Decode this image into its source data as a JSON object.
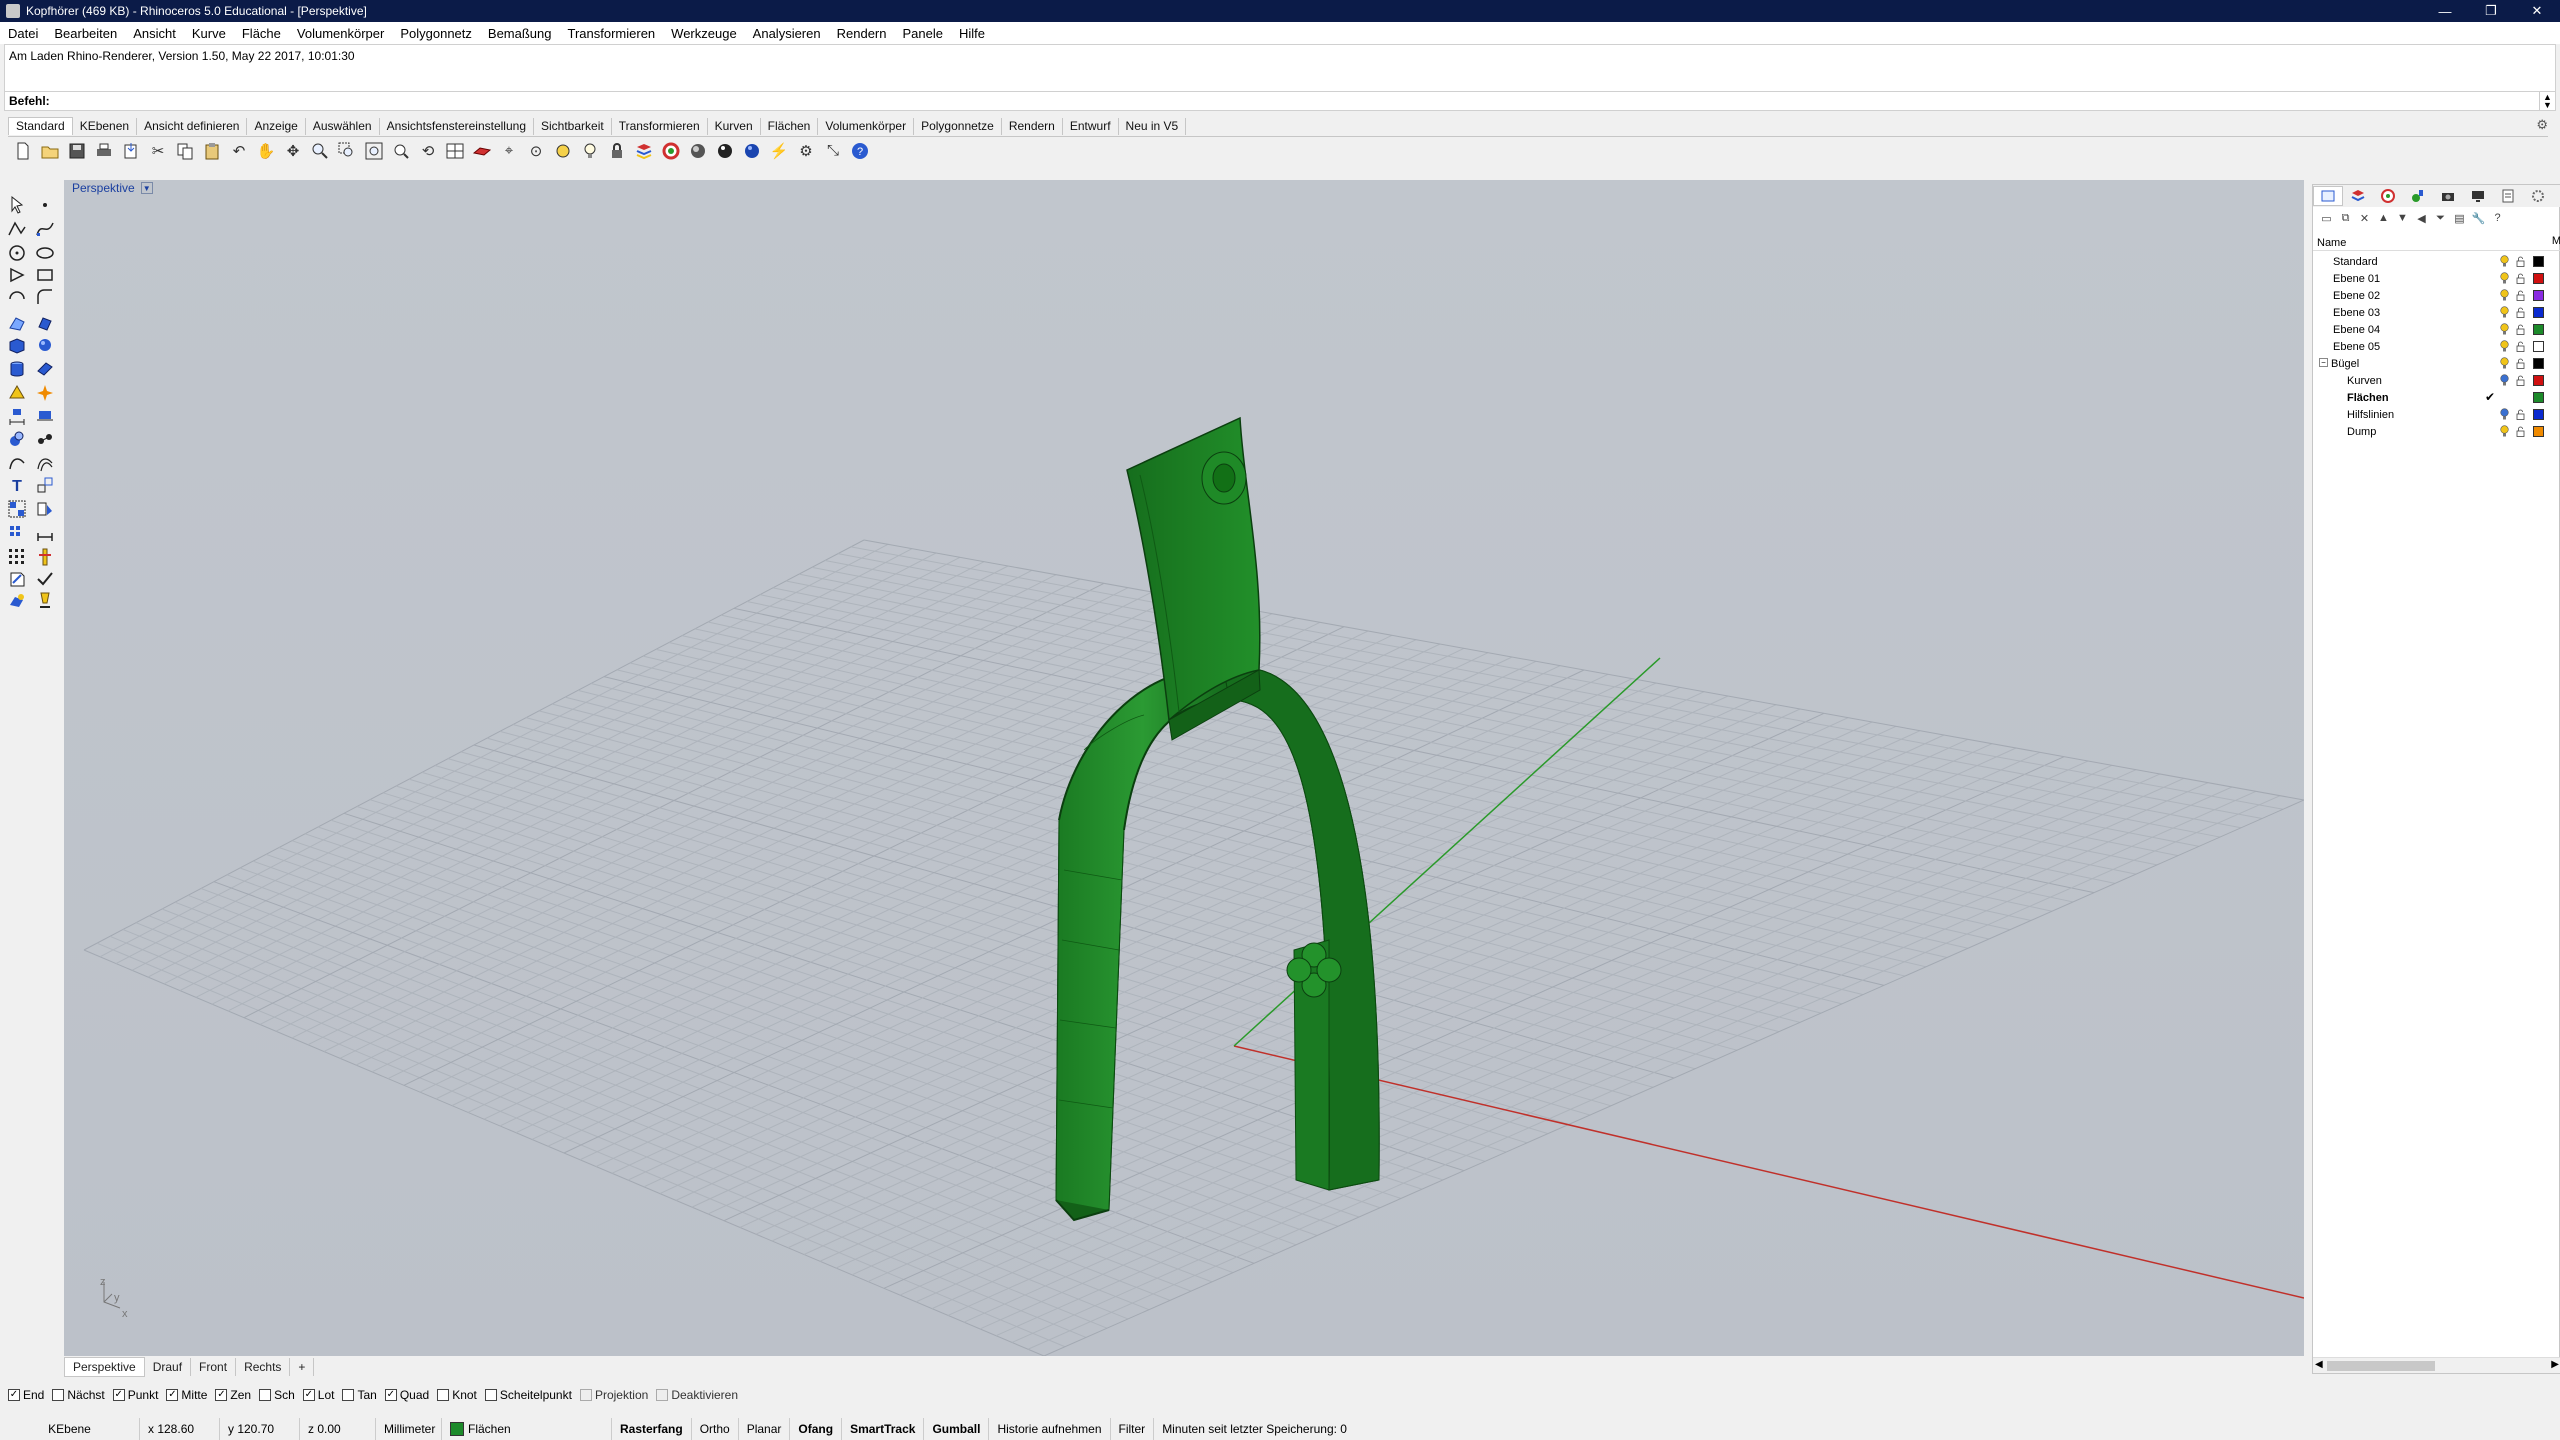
{
  "window": {
    "title": "Kopfhörer (469 KB) - Rhinoceros 5.0 Educational - [Perspektive]",
    "controls": [
      "—",
      "❐",
      "✕"
    ]
  },
  "menu": [
    "Datei",
    "Bearbeiten",
    "Ansicht",
    "Kurve",
    "Fläche",
    "Volumenkörper",
    "Polygonnetz",
    "Bemaßung",
    "Transformieren",
    "Werkzeuge",
    "Analysieren",
    "Rendern",
    "Panele",
    "Hilfe"
  ],
  "command": {
    "history": "Am Laden Rhino-Renderer, Version 1.50, May 22 2017, 10:01:30",
    "prompt": "Befehl:"
  },
  "toolbar_tabs": [
    "Standard",
    "KEbenen",
    "Ansicht definieren",
    "Anzeige",
    "Auswählen",
    "Ansichtsfenstereinstellung",
    "Sichtbarkeit",
    "Transformieren",
    "Kurven",
    "Flächen",
    "Volumenkörper",
    "Polygonnetze",
    "Rendern",
    "Entwurf",
    "Neu in V5"
  ],
  "active_toolbar_tab": "Standard",
  "viewport": {
    "label": "Perspektive",
    "tabs": [
      "Perspektive",
      "Drauf",
      "Front",
      "Rechts"
    ],
    "active_tab": "Perspektive",
    "add_tab": "+",
    "model_color": "#1f8a27",
    "x_axis_color": "#c0302a",
    "y_axis_color": "#2a9a2a",
    "axis_indicator": {
      "z": "z",
      "y": "y",
      "x": "x"
    }
  },
  "osnaps": [
    {
      "label": "End",
      "checked": true
    },
    {
      "label": "Nächst",
      "checked": false
    },
    {
      "label": "Punkt",
      "checked": true
    },
    {
      "label": "Mitte",
      "checked": true
    },
    {
      "label": "Zen",
      "checked": true
    },
    {
      "label": "Sch",
      "checked": false
    },
    {
      "label": "Lot",
      "checked": true
    },
    {
      "label": "Tan",
      "checked": false
    },
    {
      "label": "Quad",
      "checked": true
    },
    {
      "label": "Knot",
      "checked": false
    },
    {
      "label": "Scheitelpunkt",
      "checked": false
    },
    {
      "label": "Projektion",
      "checked": false,
      "disabled": true
    },
    {
      "label": "Deaktivieren",
      "checked": false,
      "disabled": true
    }
  ],
  "status": {
    "plane": "KEbene",
    "x": "x 128.60",
    "y": "y 120.70",
    "z": "z 0.00",
    "units": "Millimeter",
    "layer": "Flächen",
    "layer_color": "#1c8a2a",
    "toggles": [
      {
        "label": "Rasterfang",
        "bold": true
      },
      {
        "label": "Ortho",
        "bold": false
      },
      {
        "label": "Planar",
        "bold": false
      },
      {
        "label": "Ofang",
        "bold": true
      },
      {
        "label": "SmartTrack",
        "bold": true
      },
      {
        "label": "Gumball",
        "bold": true
      },
      {
        "label": "Historie aufnehmen",
        "bold": false
      },
      {
        "label": "Filter",
        "bold": false
      }
    ],
    "save_info": "Minuten seit letzter Speicherung: 0"
  },
  "layers_panel": {
    "header_name": "Name",
    "header_m": "M",
    "layers": [
      {
        "name": "Standard",
        "indent": 1,
        "bold": false,
        "color": "#000000",
        "current": false,
        "bulb": "#f0c419"
      },
      {
        "name": "Ebene 01",
        "indent": 1,
        "bold": false,
        "color": "#d01010",
        "current": false,
        "bulb": "#f0c419"
      },
      {
        "name": "Ebene 02",
        "indent": 1,
        "bold": false,
        "color": "#8a2be2",
        "current": false,
        "bulb": "#f0c419"
      },
      {
        "name": "Ebene 03",
        "indent": 1,
        "bold": false,
        "color": "#0a2ad0",
        "current": false,
        "bulb": "#f0c419"
      },
      {
        "name": "Ebene 04",
        "indent": 1,
        "bold": false,
        "color": "#1c8a2a",
        "current": false,
        "bulb": "#f0c419"
      },
      {
        "name": "Ebene 05",
        "indent": 1,
        "bold": false,
        "color": "#ffffff",
        "current": false,
        "bulb": "#f0c419"
      },
      {
        "name": "Bügel",
        "indent": 0,
        "bold": false,
        "color": "#000000",
        "current": false,
        "bulb": "#f0c419",
        "expander": "−"
      },
      {
        "name": "Kurven",
        "indent": 2,
        "bold": false,
        "color": "#d01010",
        "current": false,
        "bulb": "#3a70d0"
      },
      {
        "name": "Flächen",
        "indent": 2,
        "bold": true,
        "color": "#1c8a2a",
        "current": true,
        "bulb": null,
        "check": "✔"
      },
      {
        "name": "Hilfslinien",
        "indent": 2,
        "bold": false,
        "color": "#0a2ad0",
        "current": false,
        "bulb": "#3a70d0"
      },
      {
        "name": "Dump",
        "indent": 2,
        "bold": false,
        "color": "#f08a00",
        "current": false,
        "bulb": "#f0c419"
      }
    ]
  }
}
